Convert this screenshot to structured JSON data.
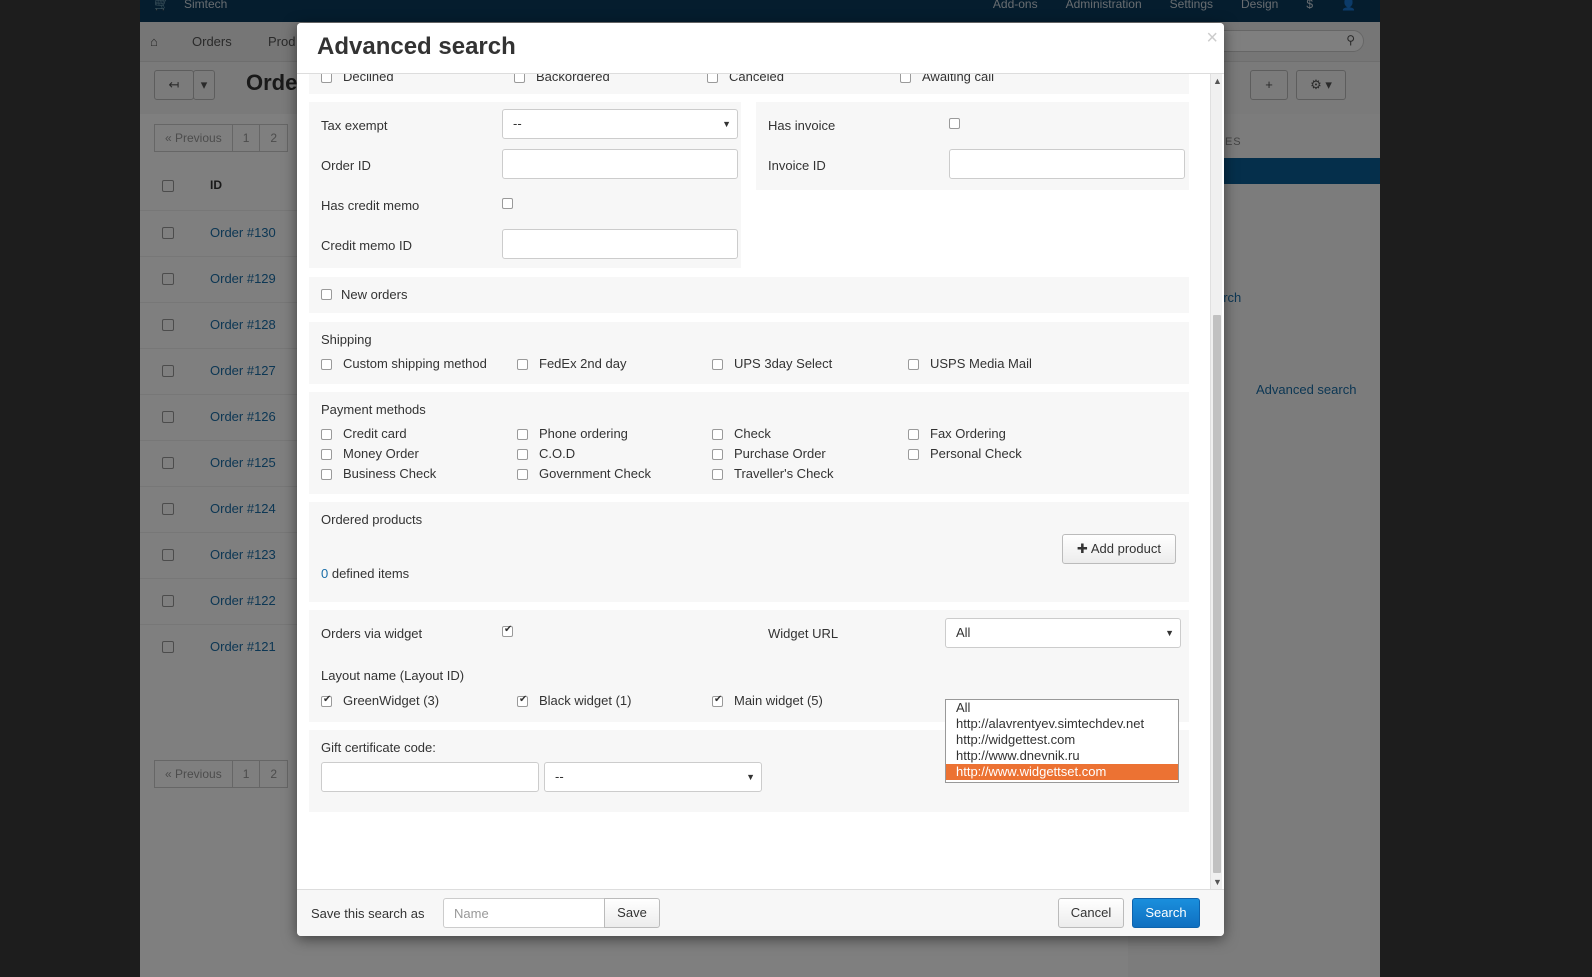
{
  "background": {
    "brand": "Simtech",
    "top_menu": [
      "Add-ons",
      "Administration",
      "Settings",
      "Design",
      "$",
      "👤"
    ],
    "nav": {
      "orders": "Orders",
      "products_partial": "Prod"
    },
    "page_title_partial": "Orde",
    "pager": {
      "previous": "« Previous",
      "page1": "1",
      "page2_partial": "2"
    },
    "table_header_id": "ID",
    "rows": [
      "Order #130",
      "Order #129",
      "Order #128",
      "Order #127",
      "Order #126",
      "Order #125",
      "Order #124",
      "Order #123",
      "Order #122",
      "Order #121"
    ],
    "side": {
      "header_partial": "HES",
      "link_partial": "arch",
      "advanced_search": "Advanced search"
    }
  },
  "modal": {
    "title": "Advanced search",
    "close": "×",
    "statuses_row": [
      "Declined",
      "Backordered",
      "Canceled",
      "Awaiting call"
    ],
    "tax_exempt": {
      "label": "Tax exempt",
      "value": "--"
    },
    "has_invoice": "Has invoice",
    "order_id": "Order ID",
    "invoice_id": "Invoice ID",
    "has_credit_memo": "Has credit memo",
    "credit_memo_id": "Credit memo ID",
    "new_orders": "New orders",
    "shipping": {
      "title": "Shipping",
      "methods": [
        "Custom shipping method",
        "FedEx 2nd day",
        "UPS 3day Select",
        "USPS Media Mail"
      ]
    },
    "payment": {
      "title": "Payment methods",
      "methods": [
        "Credit card",
        "Phone ordering",
        "Check",
        "Fax Ordering",
        "Money Order",
        "C.O.D",
        "Purchase Order",
        "Personal Check",
        "Business Check",
        "Government Check",
        "Traveller's Check"
      ]
    },
    "ordered_products": {
      "title": "Ordered products",
      "add_button": "Add product",
      "count": "0",
      "count_suffix": " defined items"
    },
    "widget": {
      "orders_via_widget": "Orders via widget",
      "widget_url_label": "Widget URL",
      "widget_url_value": "All",
      "options": [
        "All",
        "http://alavrentyev.simtechdev.net",
        "http://widgettest.com",
        "http://www.dnevnik.ru",
        "http://www.widgettset.com"
      ],
      "active_option_index": 4,
      "layout_title": "Layout name (Layout ID)",
      "layouts": [
        "GreenWidget (3)",
        "Black widget (1)",
        "Main widget (5)"
      ]
    },
    "gift": {
      "label": "Gift certificate code:",
      "select_value": "--"
    },
    "footer": {
      "save_as_label": "Save this search as",
      "name_placeholder": "Name",
      "save": "Save",
      "cancel": "Cancel",
      "search": "Search"
    }
  },
  "colors": {
    "primary": "#0f6fc0",
    "highlight": "#ec7233",
    "link": "#1a6ea8",
    "topbar": "#0b3a5d"
  }
}
